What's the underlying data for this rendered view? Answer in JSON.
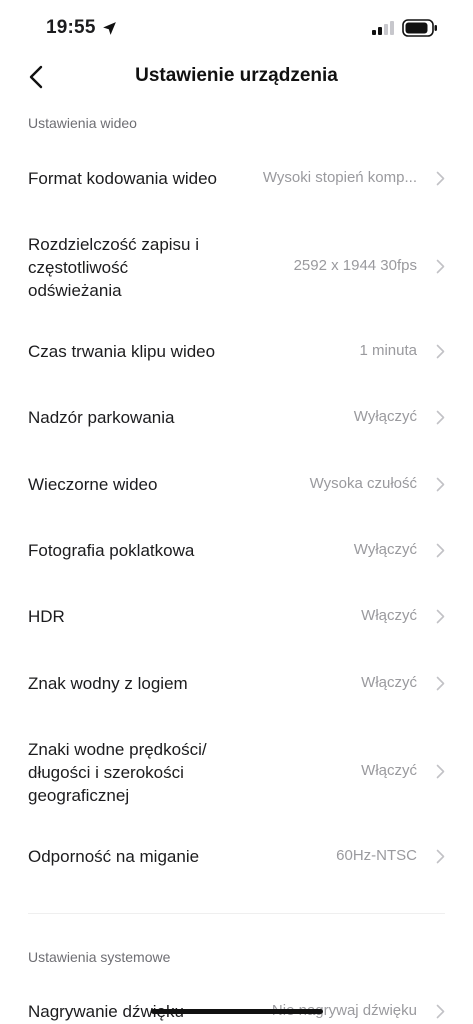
{
  "status_bar": {
    "time": "19:55"
  },
  "nav": {
    "title": "Ustawienie urządzenia"
  },
  "sections": [
    {
      "header": "Ustawienia wideo",
      "rows": [
        {
          "label": "Format kodowania wideo",
          "value": "Wysoki stopień komp..."
        },
        {
          "label": "Rozdzielczość zapisu i\nczęstotliwość\nodświeżania",
          "value": "2592 x 1944 30fps"
        },
        {
          "label": "Czas trwania klipu wideo",
          "value": "1 minuta"
        },
        {
          "label": "Nadzór parkowania",
          "value": "Wyłączyć"
        },
        {
          "label": "Wieczorne wideo",
          "value": "Wysoka czułość"
        },
        {
          "label": "Fotografia poklatkowa",
          "value": "Wyłączyć"
        },
        {
          "label": "HDR",
          "value": "Włączyć"
        },
        {
          "label": "Znak wodny z logiem",
          "value": "Włączyć"
        },
        {
          "label": "Znaki wodne prędkości/\ndługości i szerokości\ngeograficznej",
          "value": "Włączyć"
        },
        {
          "label": "Odporność na miganie",
          "value": "60Hz-NTSC"
        }
      ]
    },
    {
      "header": "Ustawienia systemowe",
      "rows": [
        {
          "label": "Nagrywanie dźwięku",
          "value": "Nie nagrywaj dźwięku"
        }
      ]
    }
  ],
  "colors": {
    "text_primary": "#1c1c1e",
    "text_secondary": "#9a9a9e",
    "section_header": "#6e6e73",
    "background": "#ffffff"
  }
}
